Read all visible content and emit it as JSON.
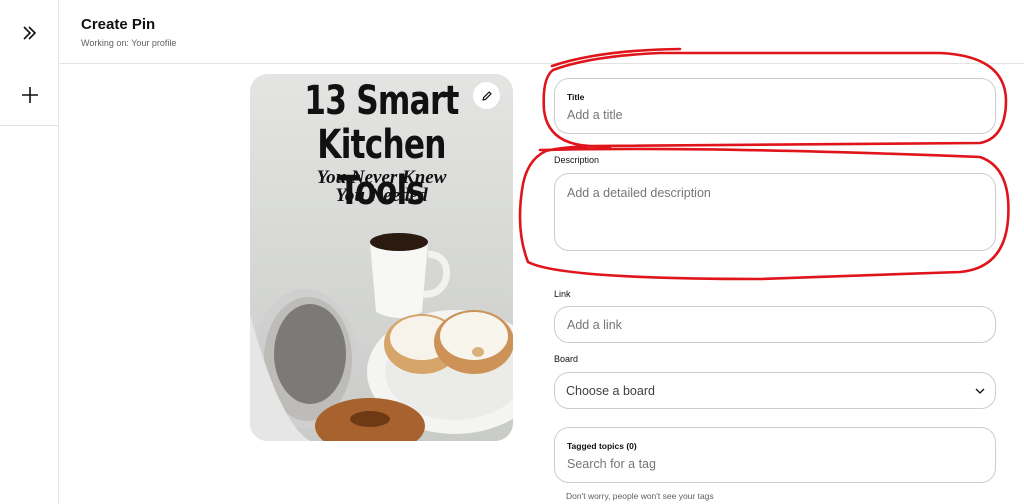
{
  "rail": {
    "expand_icon": "double-chevron-right-icon",
    "add_icon": "plus-icon"
  },
  "header": {
    "title": "Create Pin",
    "subtitle": "Working on: Your profile"
  },
  "pin_image": {
    "title_line1": "13 Smart",
    "title_line2": "Kitchen Tools",
    "subtitle_line1": "You Never Knew",
    "subtitle_line2": "You Needed",
    "edit_icon": "pencil-icon"
  },
  "form": {
    "title": {
      "label": "Title",
      "placeholder": "Add a title"
    },
    "description": {
      "label": "Description",
      "placeholder": "Add a detailed description"
    },
    "link": {
      "label": "Link",
      "placeholder": "Add a link"
    },
    "board": {
      "label": "Board",
      "value": "Choose a board",
      "icon": "chevron-down-icon"
    },
    "tags": {
      "label": "Tagged topics (0)",
      "placeholder": "Search for a tag",
      "hint": "Don't worry, people won't see your tags"
    }
  },
  "annotation": {
    "color": "#e0141b"
  }
}
